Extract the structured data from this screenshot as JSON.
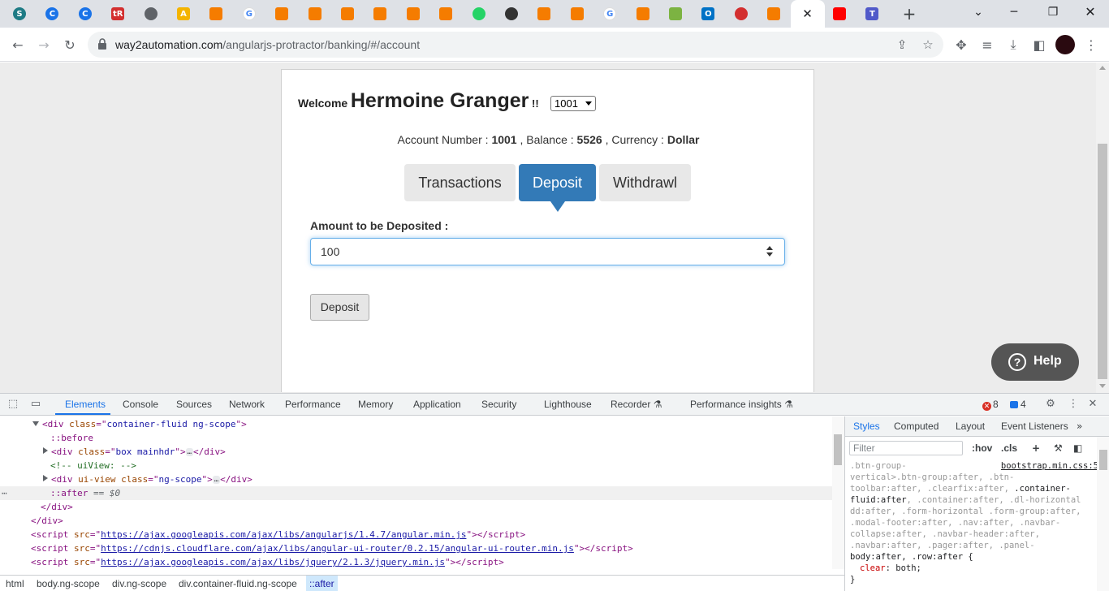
{
  "browser": {
    "tabs": [
      {
        "icon": "scribd-icon",
        "glyph": "S",
        "color": "#1e7b85"
      },
      {
        "icon": "c-circle-icon",
        "glyph": "C",
        "color": "#1a73e8"
      },
      {
        "icon": "c-circle-icon",
        "glyph": "C",
        "color": "#1a73e8"
      },
      {
        "icon": "tr-icon",
        "glyph": "tR",
        "color": "#d32f2f"
      },
      {
        "icon": "globe-icon",
        "glyph": "",
        "color": "#5f6368"
      },
      {
        "icon": "translate-icon",
        "glyph": "A",
        "color": "#f4b400"
      },
      {
        "icon": "owl-icon",
        "glyph": "",
        "color": "#f57c00"
      },
      {
        "icon": "google-icon",
        "glyph": "G",
        "color": "#4285f4"
      },
      {
        "icon": "owl-icon",
        "glyph": "",
        "color": "#f57c00"
      },
      {
        "icon": "owl-icon",
        "glyph": "",
        "color": "#f57c00"
      },
      {
        "icon": "owl-icon",
        "glyph": "",
        "color": "#f57c00"
      },
      {
        "icon": "owl-icon",
        "glyph": "",
        "color": "#f57c00"
      },
      {
        "icon": "owl-icon",
        "glyph": "",
        "color": "#f57c00"
      },
      {
        "icon": "owl-icon",
        "glyph": "",
        "color": "#f57c00"
      },
      {
        "icon": "whatsapp-icon",
        "glyph": "",
        "color": "#25d366"
      },
      {
        "icon": "panda-icon",
        "glyph": "",
        "color": "#333333"
      },
      {
        "icon": "owl-icon",
        "glyph": "",
        "color": "#f57c00"
      },
      {
        "icon": "owl-icon",
        "glyph": "",
        "color": "#f57c00"
      },
      {
        "icon": "google-icon",
        "glyph": "G",
        "color": "#4285f4"
      },
      {
        "icon": "owl-icon",
        "glyph": "",
        "color": "#f57c00"
      },
      {
        "icon": "android-icon",
        "glyph": "",
        "color": "#7cb342"
      },
      {
        "icon": "outlook-icon",
        "glyph": "O",
        "color": "#0072c6"
      },
      {
        "icon": "no-sign-icon",
        "glyph": "",
        "color": "#d32f2f"
      },
      {
        "icon": "owl-icon",
        "glyph": "",
        "color": "#f57c00"
      },
      {
        "icon": "active-tab-close-icon",
        "glyph": "✕",
        "color": "#ffffff"
      },
      {
        "icon": "youtube-icon",
        "glyph": "",
        "color": "#ff0000"
      },
      {
        "icon": "teams-icon",
        "glyph": "T",
        "color": "#5059c9"
      }
    ],
    "new_tab": "+",
    "url_host": "way2automation.com",
    "url_path": "/angularjs-protractor/banking/#/account"
  },
  "page": {
    "welcome_label": "Welcome",
    "customer_name": "Hermoine Granger",
    "bang": "!!",
    "account_select": "1001",
    "account_info": {
      "account_label": "Account Number :",
      "account_number": "1001",
      "balance_label": ", Balance :",
      "balance": "5526",
      "currency_label": ", Currency :",
      "currency": "Dollar"
    },
    "tabs": {
      "transactions": "Transactions",
      "deposit": "Deposit",
      "withdrawl": "Withdrawl"
    },
    "amount_label": "Amount to be Deposited :",
    "amount_value": "100",
    "deposit_button": "Deposit",
    "help_button": "Help",
    "colors": {
      "primary": "#337ab7",
      "help_bg": "#555555"
    }
  },
  "devtools": {
    "tabs": [
      "Elements",
      "Console",
      "Sources",
      "Network",
      "Performance",
      "Memory",
      "Application",
      "Security",
      "Lighthouse",
      "Recorder",
      "Performance insights"
    ],
    "error_count": "8",
    "message_count": "4",
    "dom": {
      "l1_tag": "div",
      "l1_attr": "class",
      "l1_val": "container-fluid ng-scope",
      "l2": "::before",
      "l3_tag": "div",
      "l3_attr": "class",
      "l3_val": "box mainhdr",
      "l3_close": "</div>",
      "l4": "<!-- uiView:  -->",
      "l5_tag": "div",
      "l5_attr1": "ui-view",
      "l5_attr2": "class",
      "l5_val": "ng-scope",
      "l5_close": "</div>",
      "l6": "::after",
      "l6_eq": "== $0",
      "l7": "</div>",
      "l8": "</div>",
      "script1": "https://ajax.googleapis.com/ajax/libs/angularjs/1.4.7/angular.min.js",
      "script2": "https://cdnjs.cloudflare.com/ajax/libs/angular-ui-router/0.2.15/angular-ui-router.min.js",
      "script3": "https://ajax.googleapis.com/ajax/libs/jquery/2.1.3/jquery.min.js"
    },
    "breadcrumbs": [
      "html",
      "body.ng-scope",
      "div.ng-scope",
      "div.container-fluid.ng-scope",
      "::after"
    ],
    "styles": {
      "tabs": [
        "Styles",
        "Computed",
        "Layout",
        "Event Listeners"
      ],
      "filter_placeholder": "Filter",
      "hov": ":hov",
      "cls": ".cls",
      "source": "bootstrap.min.css:5",
      "sel1": ".btn-group-",
      "sel2": "vertical>.btn-group:after, .btn-",
      "sel3a": "toolbar:after, .clearfix:after, ",
      "sel3b": ".container-",
      "sel4a": "fluid:after",
      "sel4b": ", .container:after, .dl-horizontal",
      "sel5": "dd:after, .form-horizontal .form-group:after,",
      "sel6": ".modal-footer:after, .nav:after, .navbar-",
      "sel7": "collapse:after, .navbar-header:after,",
      "sel8": ".navbar:after, .pager:after, .panel-",
      "sel9": "body:after, .row:after {",
      "prop": "clear",
      "value": "both;",
      "close": "}"
    }
  }
}
